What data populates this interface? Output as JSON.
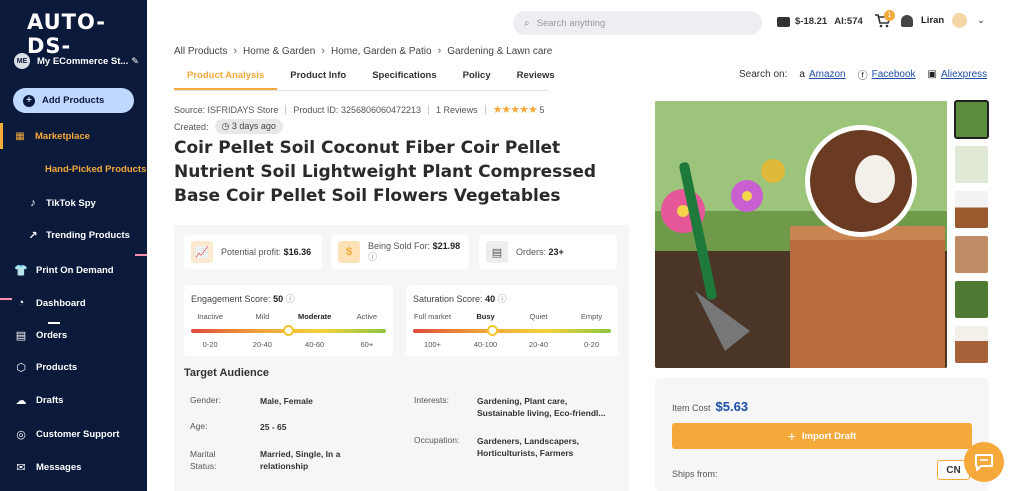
{
  "app": {
    "logo": "AUTO-DS-"
  },
  "sidebar": {
    "store_initials": "ME",
    "store_name": "My ECommerce St...",
    "add_products": "Add Products",
    "items": [
      {
        "label": "Marketplace",
        "icon": "marketplace-icon"
      },
      {
        "label": "Hand-Picked Products",
        "icon": "none"
      },
      {
        "label": "TikTok Spy",
        "icon": "tiktok-icon"
      },
      {
        "label": "Trending Products",
        "icon": "trending-icon"
      },
      {
        "label": "Print On Demand",
        "icon": "print-on-demand-icon"
      },
      {
        "label": "Dashboard",
        "icon": "dashboard-icon"
      },
      {
        "label": "Orders",
        "icon": "orders-icon"
      },
      {
        "label": "Products",
        "icon": "products-icon"
      },
      {
        "label": "Drafts",
        "icon": "drafts-icon"
      },
      {
        "label": "Customer Support",
        "icon": "support-icon"
      },
      {
        "label": "Messages",
        "icon": "messages-icon"
      }
    ]
  },
  "topbar": {
    "search_placeholder": "Search anything",
    "balance": "$-18.21",
    "ai_label": "AI:",
    "ai_credits": "574",
    "cart_badge": "1",
    "user_name": "Liran"
  },
  "breadcrumbs": [
    "All Products",
    "Home & Garden",
    "Home, Garden & Patio",
    "Gardening & Lawn care"
  ],
  "tabs": [
    "Product Analysis",
    "Product Info",
    "Specifications",
    "Policy",
    "Reviews"
  ],
  "search_on": {
    "label": "Search on:",
    "links": [
      "Amazon",
      "Facebook",
      "Aliexpress"
    ]
  },
  "product": {
    "source_label": "Source:",
    "source": "ISFRIDAYS Store",
    "id_label": "Product ID:",
    "id": "3256806060472213",
    "reviews": "1 Reviews",
    "rating": "5",
    "created_label": "Created:",
    "created": "3 days ago",
    "title": "Coir Pellet Soil Coconut Fiber Coir Pellet Nutrient Soil Lightweight Plant Compressed Base Coir Pellet Soil Flowers Vegetables"
  },
  "stats": {
    "profit_label": "Potential profit:",
    "profit": "$16.36",
    "sold_label": "Being Sold For:",
    "sold": "$21.98",
    "orders_label": "Orders:",
    "orders": "23+"
  },
  "engagement": {
    "label": "Engagement Score:",
    "score": "50",
    "level": 0.5,
    "categories": [
      "Inactive",
      "Mild",
      "Moderate",
      "Active"
    ],
    "ranges": [
      "0-20",
      "20-40",
      "40-60",
      "60+"
    ],
    "active_index": 2
  },
  "saturation": {
    "label": "Saturation Score:",
    "score": "40",
    "level": 0.4,
    "categories": [
      "Full market",
      "Busy",
      "Quiet",
      "Empty"
    ],
    "ranges": [
      "100+",
      "40-100",
      "20-40",
      "0-20"
    ],
    "active_index": 1
  },
  "audience": {
    "heading": "Target Audience",
    "gender_label": "Gender:",
    "gender": "Male, Female",
    "age_label": "Age:",
    "age": "25 - 65",
    "marital_label": "Marital Status:",
    "marital": "Married, Single, In a relationship",
    "interests_label": "Interests:",
    "interests": "Gardening, Plant care, Sustainable living, Eco-friendl...",
    "occupation_label": "Occupation:",
    "occupation": "Gardeners, Landscapers, Horticulturists, Farmers"
  },
  "buy": {
    "item_cost_label": "Item Cost",
    "item_cost": "$5.63",
    "import": "Import Draft",
    "ships_from": "Ships from:",
    "country": "CN"
  },
  "colors": {
    "accent": "#f5a93b",
    "sidebar": "#0b1a3b",
    "link": "#1b4fa8"
  }
}
